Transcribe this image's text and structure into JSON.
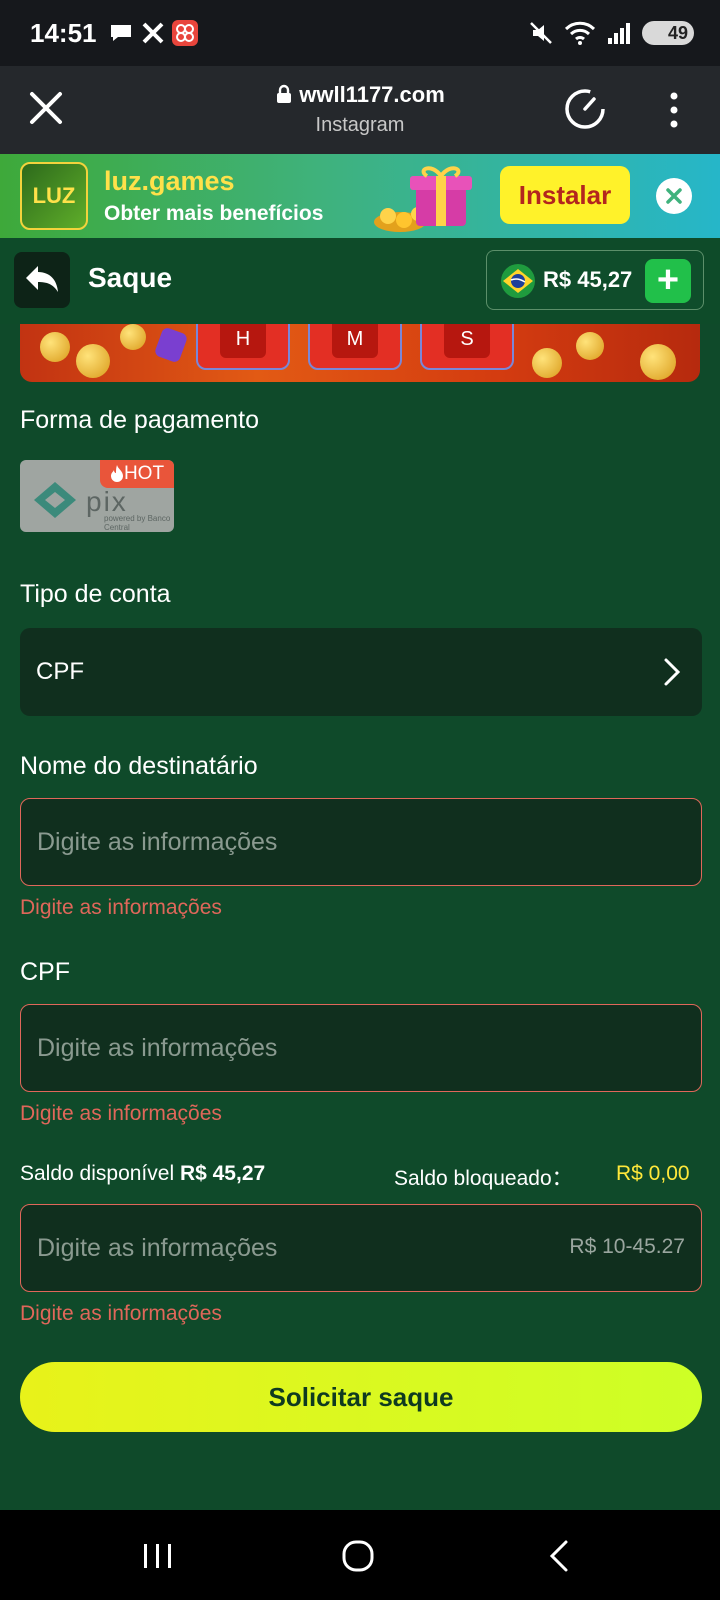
{
  "status_bar": {
    "time": "14:51",
    "battery": "49",
    "icons": [
      "chat-icon",
      "x-icon",
      "app-icon",
      "mute-icon",
      "wifi-icon",
      "signal-icon"
    ]
  },
  "browser": {
    "url": "wwll1177.com",
    "source": "Instagram"
  },
  "promo": {
    "logo_text": "LUZ",
    "title": "luz.games",
    "subtitle": "Obter mais benefícios",
    "install_label": "Instalar"
  },
  "header": {
    "title": "Saque",
    "balance": "R$ 45,27",
    "add_label": "+"
  },
  "banner": {
    "timer_labels": [
      "H",
      "M",
      "S"
    ]
  },
  "form": {
    "payment_label": "Forma de pagamento",
    "payment_option": {
      "name": "pix",
      "badge": "HOT",
      "caption": "powered by Banco Central"
    },
    "account_type_label": "Tipo de conta",
    "account_type_value": "CPF",
    "recipient_label": "Nome do destinatário",
    "recipient_placeholder": "Digite as informações",
    "recipient_error": "Digite as informações",
    "cpf_label": "CPF",
    "cpf_placeholder": "Digite as informações",
    "cpf_error": "Digite as informações",
    "available_label": "Saldo disponível",
    "available_value": "R$ 45,27",
    "blocked_label": "Saldo bloqueado：",
    "blocked_value": "R$ 0,00",
    "amount_placeholder": "Digite as informações",
    "amount_range": "R$ 10-45.27",
    "amount_error": "Digite as informações",
    "submit_label": "Solicitar saque"
  },
  "colors": {
    "page_bg": "#0f4a2a",
    "field_bg": "#102f1e",
    "error": "#e0675a",
    "accent_yellow": "#ffe83a",
    "submit": "#d8f71f"
  }
}
